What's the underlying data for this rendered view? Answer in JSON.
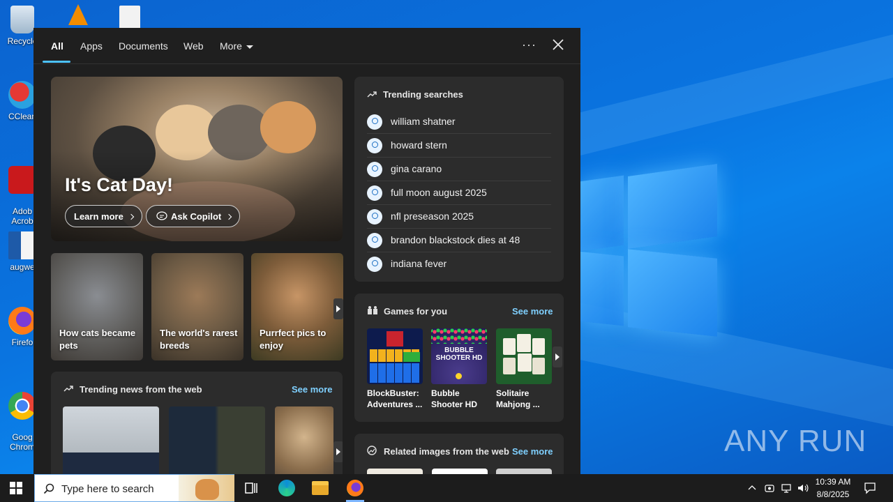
{
  "desktop": {
    "icons": [
      {
        "label": "Recycle",
        "icon": "recycle-bin-icon"
      },
      {
        "label": "CClean",
        "icon": "ccleaner-icon"
      },
      {
        "label": "Adob\nAcrob",
        "icon": "adobe-acrobat-icon"
      },
      {
        "label": "augwe",
        "icon": "word-document-icon"
      },
      {
        "label": "Firefo",
        "icon": "firefox-icon"
      },
      {
        "label": "Goog\nChrom",
        "icon": "chrome-icon"
      }
    ],
    "watermark": "ANY RUN"
  },
  "search_panel": {
    "tabs": [
      {
        "label": "All",
        "active": true
      },
      {
        "label": "Apps"
      },
      {
        "label": "Documents"
      },
      {
        "label": "Web"
      },
      {
        "label": "More"
      }
    ],
    "more_options_label": "···",
    "hero": {
      "title": "It's Cat Day!",
      "learn_more": "Learn more",
      "ask_copilot": "Ask Copilot"
    },
    "tiles": [
      {
        "label": "How cats became pets"
      },
      {
        "label": "The world's rarest breeds"
      },
      {
        "label": "Purrfect pics to enjoy"
      }
    ],
    "trending": {
      "title": "Trending searches",
      "items": [
        "william shatner",
        "howard stern",
        "gina carano",
        "full moon august 2025",
        "nfl preseason 2025",
        "brandon blackstock dies at 48",
        "indiana fever"
      ]
    },
    "games": {
      "title": "Games for you",
      "see_more": "See more",
      "items": [
        {
          "name": "BlockBuster: Adventures ..."
        },
        {
          "name": "Bubble Shooter HD",
          "logo_text": "BUBBLE SHOOTER HD"
        },
        {
          "name": "Solitaire Mahjong ..."
        }
      ]
    },
    "news": {
      "title": "Trending news from the web",
      "see_more": "See more"
    },
    "related": {
      "title": "Related images from the web",
      "see_more": "See more"
    }
  },
  "taskbar": {
    "search_placeholder": "Type here to search",
    "time": "10:39 AM",
    "date": "8/8/2025"
  },
  "colors": {
    "accent": "#4cc2ff",
    "link": "#7fd0ff",
    "panel_bg": "#1f1f1f",
    "card_bg": "#2c2c2c"
  }
}
